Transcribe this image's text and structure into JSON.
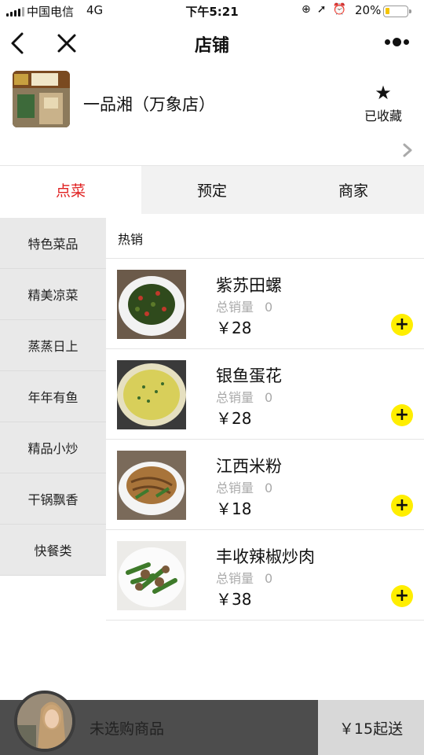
{
  "status_bar": {
    "carrier": "中国电信",
    "network": "4G",
    "time": "下午5:21",
    "battery": "20%",
    "battery_level": 0.2,
    "battery_color": "#f5c400",
    "icons": [
      "orientation-lock-icon",
      "location-icon",
      "alarm-icon"
    ]
  },
  "nav": {
    "title": "店铺",
    "back_icon": "chevron-left-icon",
    "close_icon": "close-icon",
    "more_icon": "more-dots-icon"
  },
  "shop": {
    "name": "一品湘（万象店）",
    "favorite_label": "已收藏",
    "favorite_icon": "star-icon"
  },
  "tabs": [
    {
      "label": "点菜",
      "active": true
    },
    {
      "label": "预定",
      "active": false
    },
    {
      "label": "商家",
      "active": false
    }
  ],
  "categories": [
    "特色菜品",
    "精美凉菜",
    "蒸蒸日上",
    "年年有鱼",
    "精品小炒",
    "干锅飘香",
    "快餐类"
  ],
  "section_title": "热销",
  "sales_label": "总销量",
  "dishes": [
    {
      "name": "紫苏田螺",
      "sales": "0",
      "price": "￥28"
    },
    {
      "name": "银鱼蛋花",
      "sales": "0",
      "price": "￥28"
    },
    {
      "name": "江西米粉",
      "sales": "0",
      "price": "￥18"
    },
    {
      "name": "丰收辣椒炒肉",
      "sales": "0",
      "price": "￥38"
    }
  ],
  "cart": {
    "empty_label": "未选购商品",
    "min_order": "￥15起送"
  },
  "colors": {
    "accent": "#e02020",
    "add_button": "#ffee00",
    "cart_bar": "#4d4d4d"
  }
}
